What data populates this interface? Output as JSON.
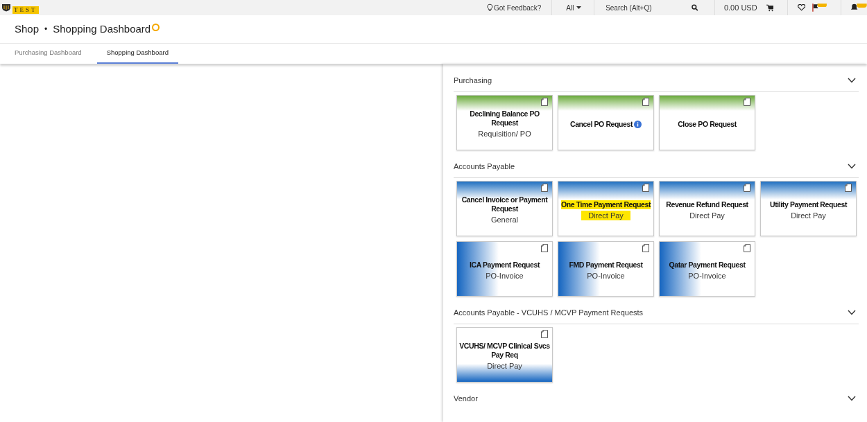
{
  "topbar": {
    "logo": "TEST",
    "feedback": "Got Feedback?",
    "scope": "All",
    "search": {
      "placeholder": "Search (Alt+Q)"
    },
    "cart_total": "0.00 USD"
  },
  "header": {
    "section": "Shop",
    "separator": "•",
    "title": "Shopping Dashboard"
  },
  "tabs": [
    {
      "label": "Purchasing Dashboard",
      "selected": false
    },
    {
      "label": "Shopping Dashboard",
      "selected": true
    }
  ],
  "sections": [
    {
      "title": "Purchasing",
      "tiles": [
        {
          "kind": "top-green",
          "title": "Declining Balance PO Request",
          "subtitle": "Requisition/ PO",
          "highlighted": false,
          "info": false
        },
        {
          "kind": "top-green",
          "title": "Cancel PO Request",
          "highlighted": false,
          "info": true
        },
        {
          "kind": "top-green",
          "title": "Close PO Request",
          "highlighted": false,
          "info": false
        }
      ]
    },
    {
      "title": "Accounts Payable",
      "tiles": [
        {
          "kind": "top-blue",
          "title": "Cancel Invoice or Payment Request",
          "subtitle": "General",
          "highlighted": false,
          "info": false
        },
        {
          "kind": "top-blue",
          "title": "One Time Payment Request",
          "subtitle": "Direct Pay",
          "highlighted": true,
          "info": false
        },
        {
          "kind": "top-blue",
          "title": "Revenue Refund Request",
          "subtitle": "Direct Pay",
          "highlighted": false,
          "info": false
        },
        {
          "kind": "top-blue",
          "title": "Utility Payment Request",
          "subtitle": "Direct Pay",
          "highlighted": false,
          "info": false
        },
        {
          "kind": "left-blue",
          "title": "ICA Payment Request",
          "subtitle": "PO-Invoice",
          "highlighted": false,
          "info": false
        },
        {
          "kind": "left-blue",
          "title": "FMD Payment Request",
          "subtitle": "PO-Invoice",
          "highlighted": false,
          "info": false
        },
        {
          "kind": "left-blue",
          "title": "Qatar Payment Request",
          "subtitle": "PO-Invoice",
          "highlighted": false,
          "info": false
        }
      ]
    },
    {
      "title": "Accounts Payable - VCUHS / MCVP Payment Requests",
      "tiles": [
        {
          "kind": "bottom-blue",
          "title": "VCUHS/ MCVP Clinical Svcs Pay Req",
          "subtitle": "Direct Pay",
          "highlighted": false,
          "info": false
        }
      ]
    },
    {
      "title": "Vendor"
    }
  ]
}
